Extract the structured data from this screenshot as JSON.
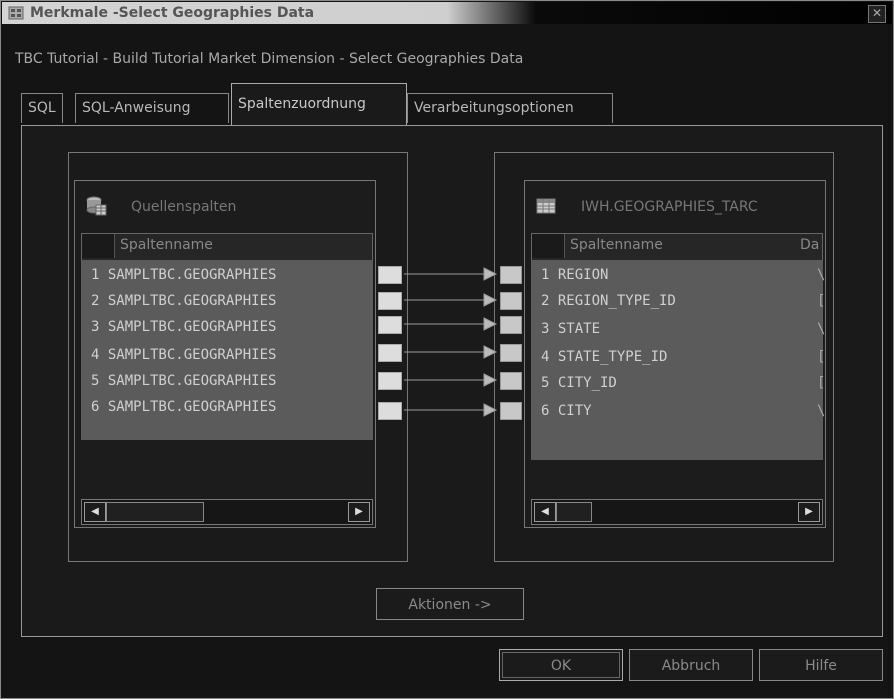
{
  "window": {
    "title": "Merkmale -Select Geographies Data",
    "close_glyph": "✕",
    "subtitle": "TBC Tutorial - Build Tutorial Market Dimension - Select Geographies Data"
  },
  "tabs": [
    {
      "label": "SQL"
    },
    {
      "label": "SQL-Anweisung"
    },
    {
      "label": "Spaltenzuordnung",
      "active": true
    },
    {
      "label": "Verarbeitungsoptionen"
    }
  ],
  "source": {
    "header": "Quellenspalten",
    "column_header": "Spaltenname",
    "rows": [
      "1 SAMPLTBC.GEOGRAPHIES",
      "2 SAMPLTBC.GEOGRAPHIES",
      "3 SAMPLTBC.GEOGRAPHIES",
      "4 SAMPLTBC.GEOGRAPHIES",
      "5 SAMPLTBC.GEOGRAPHIES",
      "6 SAMPLTBC.GEOGRAPHIES"
    ]
  },
  "target": {
    "header": "IWH.GEOGRAPHIES_TARC",
    "column_header": "Spaltenname",
    "column_header2": "Da",
    "rows": [
      {
        "name": "1 REGION",
        "type": "\\"
      },
      {
        "name": "2 REGION_TYPE_ID",
        "type": "["
      },
      {
        "name": "3 STATE",
        "type": "\\"
      },
      {
        "name": "4 STATE_TYPE_ID",
        "type": "["
      },
      {
        "name": "5 CITY_ID",
        "type": "["
      },
      {
        "name": "6 CITY",
        "type": "\\"
      }
    ]
  },
  "actions_button": "Aktionen ->",
  "footer": {
    "ok": "OK",
    "cancel": "Abbruch",
    "help": "Hilfe"
  },
  "colors": {
    "list_bg": "#5b5b5b",
    "window_bg": "#141414"
  }
}
